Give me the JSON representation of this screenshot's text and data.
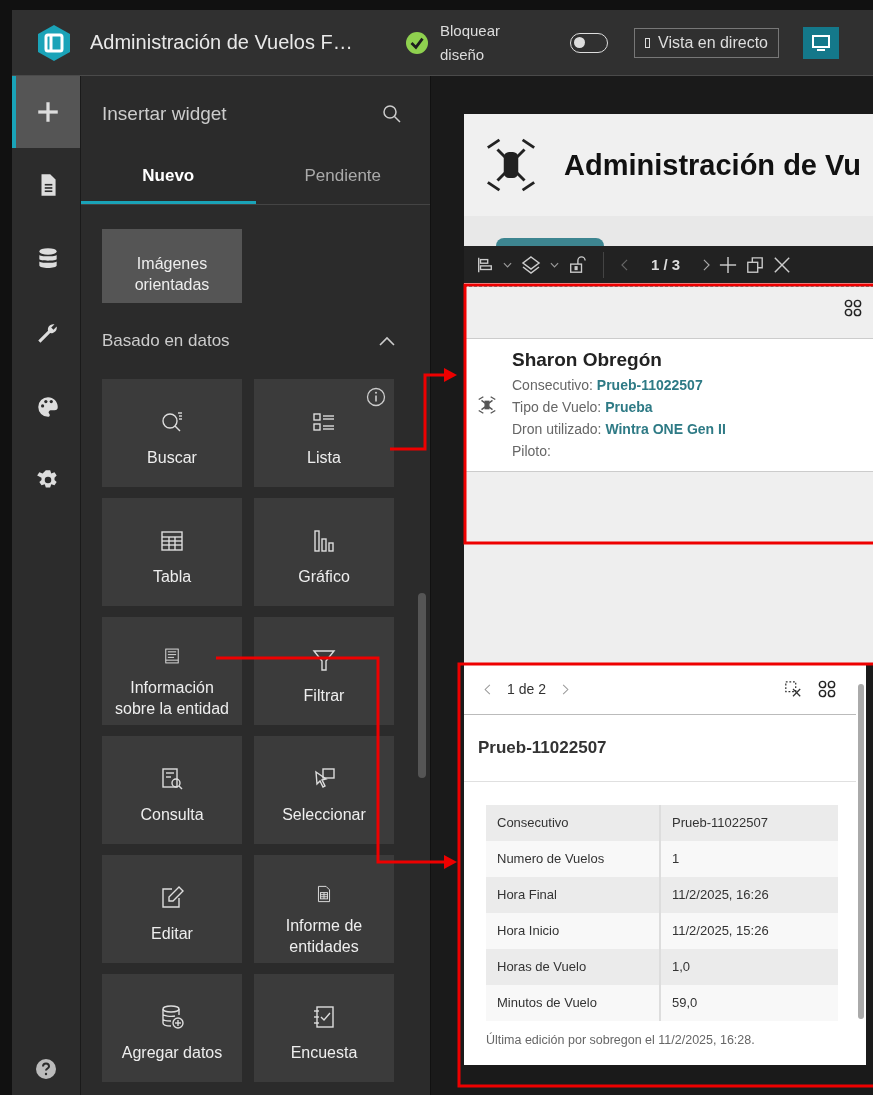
{
  "topbar": {
    "title": "Administración de Vuelos F…",
    "lock_label": "Bloquear diseño",
    "lock_layout": {
      "on": false
    },
    "live_view_button": "Vista en directo"
  },
  "rail": [
    {
      "kind": "plus",
      "selected": true
    },
    {
      "kind": "page",
      "selected": false
    },
    {
      "kind": "data",
      "selected": false
    },
    {
      "kind": "wrench",
      "selected": false
    },
    {
      "kind": "palette",
      "selected": false
    },
    {
      "kind": "gear",
      "selected": false
    }
  ],
  "panel": {
    "title": "Insertar widget",
    "tabs": [
      {
        "label": "Nuevo",
        "selected": true
      },
      {
        "label": "Pendiente",
        "selected": false
      }
    ],
    "top_widget": {
      "label": "Imágenes orientadas",
      "selected": true
    },
    "section": {
      "title": "Basado en datos",
      "expanded": true,
      "widgets": [
        {
          "kind": "search",
          "label": "Buscar",
          "info": false
        },
        {
          "kind": "list",
          "label": "Lista",
          "info": true
        },
        {
          "kind": "table",
          "label": "Tabla",
          "info": false
        },
        {
          "kind": "chart",
          "label": "Gráfico",
          "info": false
        },
        {
          "kind": "info",
          "label": "Información sobre la entidad",
          "info": false
        },
        {
          "kind": "filter",
          "label": "Filtrar",
          "info": false
        },
        {
          "kind": "query",
          "label": "Consulta",
          "info": false
        },
        {
          "kind": "select",
          "label": "Seleccionar",
          "info": false
        },
        {
          "kind": "edit",
          "label": "Editar",
          "info": false
        },
        {
          "kind": "report",
          "label": "Informe de entidades",
          "info": false
        },
        {
          "kind": "adddata",
          "label": "Agregar datos",
          "info": false
        },
        {
          "kind": "survey",
          "label": "Encuesta",
          "info": false
        }
      ]
    }
  },
  "canvas": {
    "app_title": "Administración de Vu",
    "toolbar": {
      "page": "1 / 3"
    },
    "list_widget": {
      "name": "Sharon Obregón",
      "fields": [
        {
          "label": "Consecutivo:",
          "value": "Prueb-11022507"
        },
        {
          "label": "Tipo de Vuelo:",
          "value": "Prueba"
        },
        {
          "label": "Dron utilizado:",
          "value": "Wintra ONE Gen II"
        },
        {
          "label": "Piloto:"
        }
      ]
    },
    "feature_info": {
      "pager": "1 de 2",
      "title": "Prueb-11022507",
      "rows": [
        {
          "label": "Consecutivo",
          "value": "Prueb-11022507"
        },
        {
          "label": "Numero de Vuelos",
          "value": "1"
        },
        {
          "label": "Hora Final",
          "value": "11/2/2025, 16:26"
        },
        {
          "label": "Hora Inicio",
          "value": "11/2/2025, 15:26"
        },
        {
          "label": "Horas de Vuelo",
          "value": "1,0"
        },
        {
          "label": "Minutos de Vuelo",
          "value": "59,0"
        }
      ],
      "footer": "Última edición por sobregon el 11/2/2025, 16:28."
    }
  }
}
